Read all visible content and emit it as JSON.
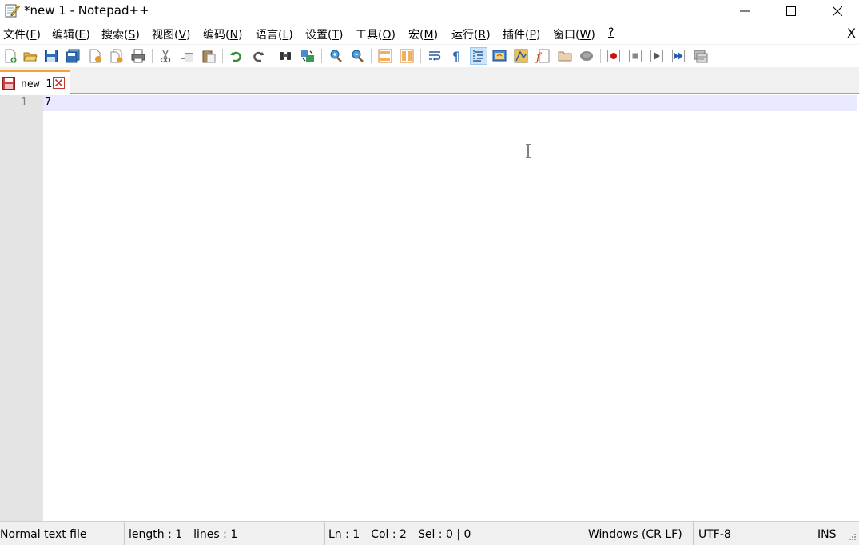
{
  "window": {
    "title": "*new 1 - Notepad++",
    "app_icon": "notepad-icon",
    "controls": [
      "minimize-icon",
      "maximize-icon",
      "close-icon"
    ]
  },
  "menu": {
    "items": [
      {
        "label": "文件(",
        "key": "F",
        "end": ")"
      },
      {
        "label": "编辑(",
        "key": "E",
        "end": ")"
      },
      {
        "label": "搜索(",
        "key": "S",
        "end": ")"
      },
      {
        "label": "视图(",
        "key": "V",
        "end": ")"
      },
      {
        "label": "编码(",
        "key": "N",
        "end": ")"
      },
      {
        "label": "语言(",
        "key": "L",
        "end": ")"
      },
      {
        "label": "设置(",
        "key": "T",
        "end": ")"
      },
      {
        "label": "工具(",
        "key": "O",
        "end": ")"
      },
      {
        "label": "宏(",
        "key": "M",
        "end": ")"
      },
      {
        "label": "运行(",
        "key": "R",
        "end": ")"
      },
      {
        "label": "插件(",
        "key": "P",
        "end": ")"
      },
      {
        "label": "窗口(",
        "key": "W",
        "end": ")"
      },
      {
        "label": "",
        "key": "?",
        "end": ""
      }
    ],
    "close_document": "X"
  },
  "toolbar": {
    "icons": [
      "new-file-icon",
      "open-file-icon",
      "save-icon",
      "save-all-icon",
      "close-icon",
      "close-all-icon",
      "print-icon",
      "cut-icon",
      "copy-icon",
      "paste-icon",
      "undo-icon",
      "redo-icon",
      "find-icon",
      "replace-icon",
      "zoom-in-icon",
      "zoom-out-icon",
      "sync-vertical-icon",
      "sync-horizontal-icon",
      "word-wrap-icon",
      "show-all-chars-icon",
      "indent-guide-icon",
      "language-icon",
      "document-map-icon",
      "function-list-icon",
      "folder-workspace-icon",
      "monitoring-icon",
      "record-macro-icon",
      "stop-macro-icon",
      "play-macro-icon",
      "run-macro-multiple-icon",
      "save-macro-icon"
    ]
  },
  "tabs": [
    {
      "label": "new 1",
      "modified": true
    }
  ],
  "editor": {
    "lines": [
      {
        "number": "1",
        "text": "7"
      }
    ]
  },
  "status": {
    "file_type": "Normal text file",
    "length": "length : 1",
    "lines": "lines : 1",
    "ln": "Ln : 1",
    "col": "Col : 2",
    "sel": "Sel : 0 | 0",
    "eol": "Windows (CR LF)",
    "encoding": "UTF-8",
    "mode": "INS"
  },
  "colors": {
    "current_line": "#e8e8ff",
    "tab_accent": "#f7a23b",
    "gutter": "#e4e4e4"
  }
}
